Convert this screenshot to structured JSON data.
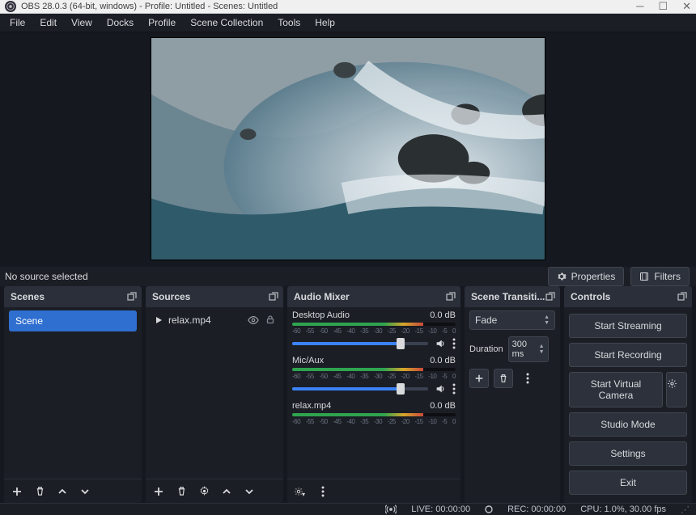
{
  "titlebar": {
    "text": "OBS 28.0.3 (64-bit, windows) - Profile: Untitled - Scenes: Untitled"
  },
  "menu": [
    "File",
    "Edit",
    "View",
    "Docks",
    "Profile",
    "Scene Collection",
    "Tools",
    "Help"
  ],
  "toolbar": {
    "no_source": "No source selected",
    "properties": "Properties",
    "filters": "Filters"
  },
  "docks": {
    "scenes": {
      "title": "Scenes",
      "items": [
        "Scene"
      ],
      "selected": 0
    },
    "sources": {
      "title": "Sources",
      "items": [
        {
          "name": "relax.mp4",
          "visible": true,
          "locked": true
        }
      ]
    },
    "mixer": {
      "title": "Audio Mixer",
      "ticks": [
        "-60",
        "-55",
        "-50",
        "-45",
        "-40",
        "-35",
        "-30",
        "-25",
        "-20",
        "-15",
        "-10",
        "-5",
        "0"
      ],
      "channels": [
        {
          "name": "Desktop Audio",
          "db": "0.0 dB",
          "fill": 80
        },
        {
          "name": "Mic/Aux",
          "db": "0.0 dB",
          "fill": 80
        },
        {
          "name": "relax.mp4",
          "db": "0.0 dB",
          "fill": 80
        }
      ]
    },
    "transitions": {
      "title": "Scene Transiti...",
      "selected": "Fade",
      "duration_label": "Duration",
      "duration": "300 ms"
    },
    "controls": {
      "title": "Controls",
      "buttons": [
        "Start Streaming",
        "Start Recording",
        "Start Virtual Camera",
        "Studio Mode",
        "Settings",
        "Exit"
      ]
    }
  },
  "status": {
    "live": "LIVE: 00:00:00",
    "rec": "REC: 00:00:00",
    "cpu": "CPU: 1.0%, 30.00 fps"
  }
}
